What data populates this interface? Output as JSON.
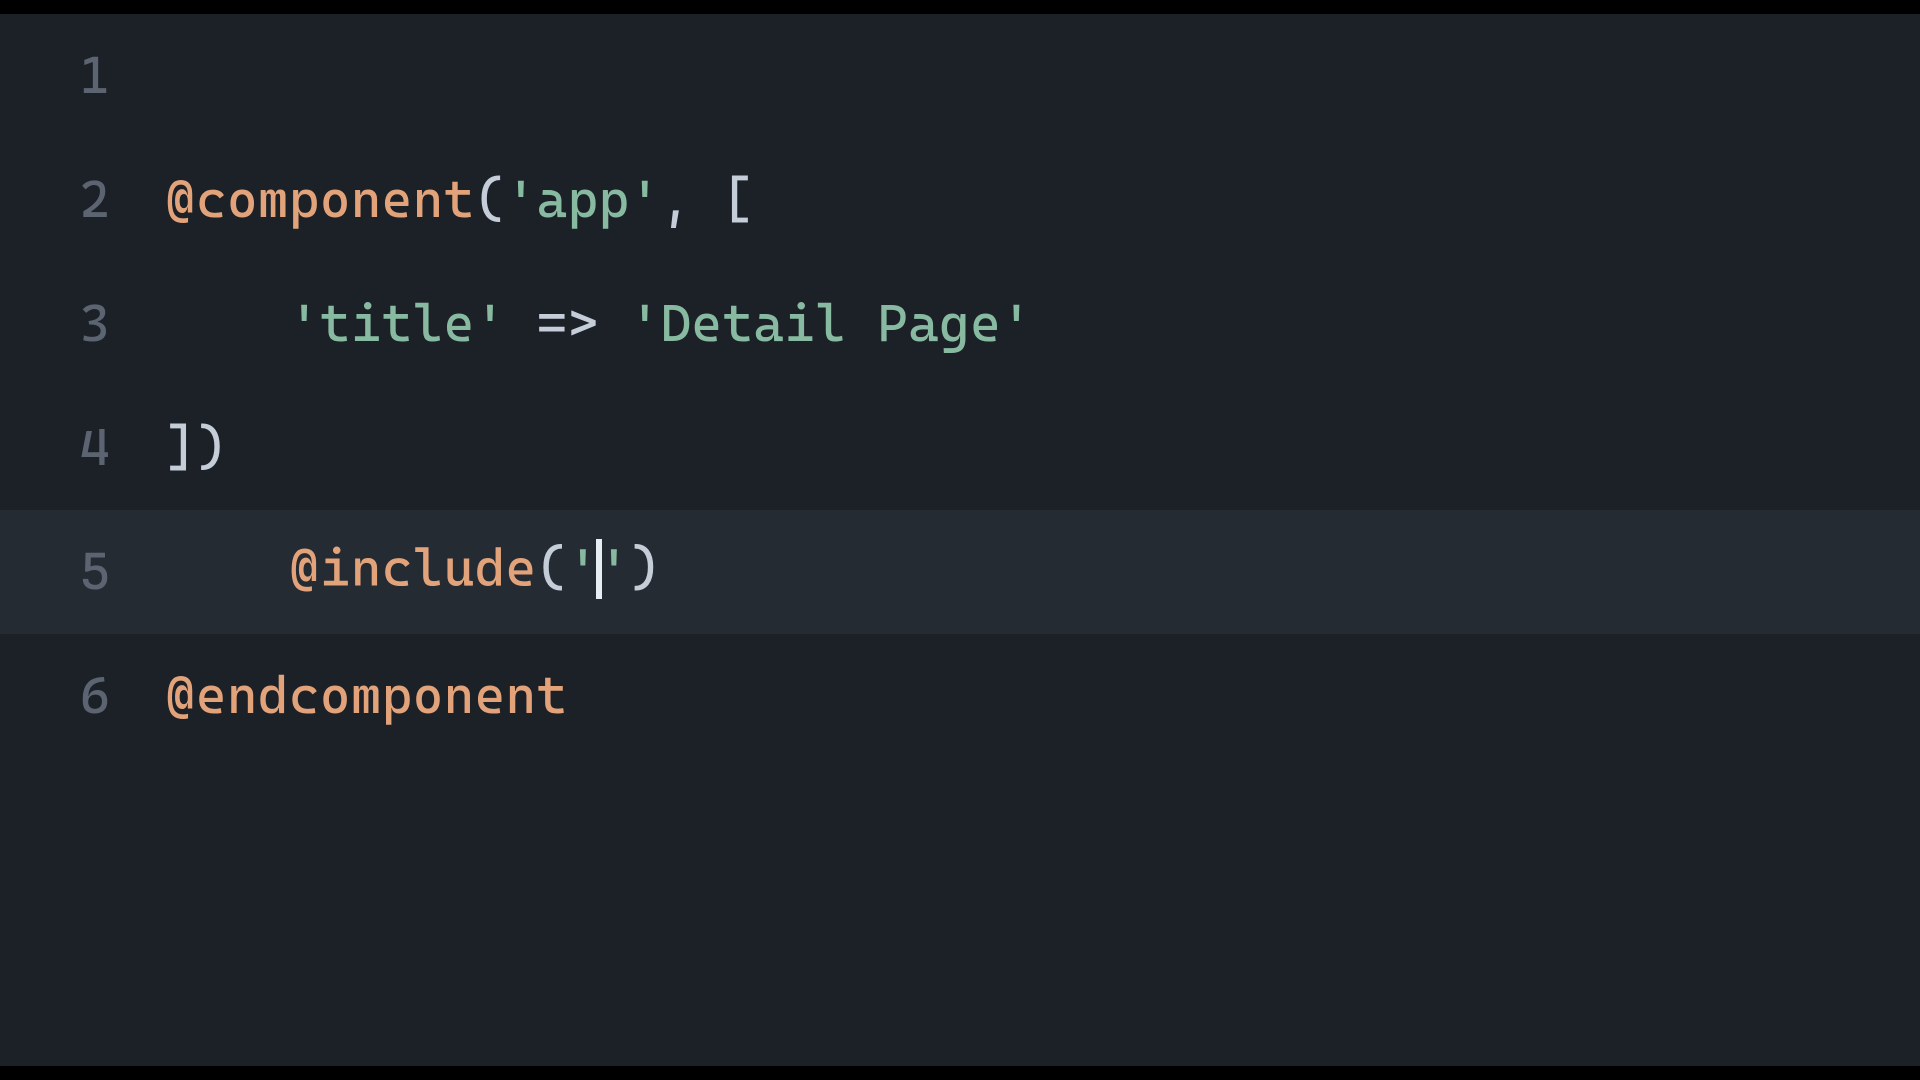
{
  "gutter": {
    "1": "1",
    "2": "2",
    "3": "3",
    "4": "4",
    "5": "5",
    "6": "6"
  },
  "code": {
    "l2": {
      "directive": "@component",
      "open": "(",
      "str1": "'app'",
      "comma": ", [",
      "close": ""
    },
    "l3": {
      "indent": "    ",
      "key": "'title'",
      "arrow": " => ",
      "val": "'Detail Page'"
    },
    "l4": {
      "close": "])"
    },
    "l5": {
      "indent": "    ",
      "directive": "@include",
      "open": "(",
      "q1": "'",
      "q2": "'",
      "close": ")"
    },
    "l6": {
      "directive": "@endcomponent"
    }
  },
  "active_line": 5
}
